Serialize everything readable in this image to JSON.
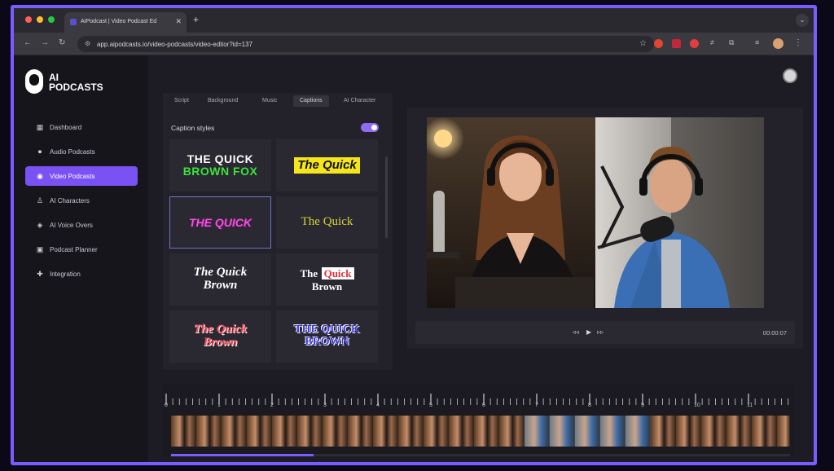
{
  "browser": {
    "tab_title": "AIPodcast | Video Podcast Ed",
    "tab_close": "✕",
    "new_tab": "+",
    "url": "app.aipodcasts.io/video-podcasts/video-editor?id=137"
  },
  "brand": {
    "line1": "AI",
    "line2": "PODCASTS"
  },
  "sidebar": {
    "items": [
      {
        "label": "Dashboard",
        "icon": "grid-icon",
        "glyph": "▦",
        "active": false
      },
      {
        "label": "Audio Podcasts",
        "icon": "microphone-icon",
        "glyph": "🎙",
        "active": false
      },
      {
        "label": "Video Podcasts",
        "icon": "broadcast-icon",
        "glyph": "◉",
        "active": true
      },
      {
        "label": "AI Characters",
        "icon": "character-icon",
        "glyph": "♙",
        "active": false
      },
      {
        "label": "AI Voice Overs",
        "icon": "voice-icon",
        "glyph": "◈",
        "active": false
      },
      {
        "label": "Podcast Planner",
        "icon": "calendar-icon",
        "glyph": "▣",
        "active": false
      },
      {
        "label": "Integration",
        "icon": "puzzle-icon",
        "glyph": "✚",
        "active": false
      }
    ]
  },
  "editor": {
    "tabs": [
      "Script",
      "Background",
      "Music",
      "Captions",
      "AI Character"
    ],
    "active_tab": "Captions",
    "caption_title": "Caption styles",
    "caption_enabled": true,
    "styles": [
      {
        "lines": [
          "THE QUICK",
          "BROWN FOX"
        ]
      },
      {
        "lines": [
          "The Quick"
        ]
      },
      {
        "lines": [
          "THE QUICK"
        ]
      },
      {
        "lines": [
          "The Quick"
        ]
      },
      {
        "lines": [
          "The Quick",
          "Brown"
        ]
      },
      {
        "lines": [
          "The",
          "Quick",
          "Brown"
        ]
      },
      {
        "lines": [
          "The Quick",
          "Brown"
        ]
      },
      {
        "lines": [
          "THE QUICK",
          "BROWN"
        ]
      }
    ]
  },
  "player": {
    "rewind": "◃◃",
    "play": "▶",
    "forward": "▹▹",
    "timecode": "00:00:07"
  },
  "timeline": {
    "labels": [
      "0",
      "1",
      "2",
      "3",
      "4",
      "5",
      "6",
      "7",
      "8",
      "9",
      "10",
      "11"
    ],
    "progress": 0.23
  },
  "colors": {
    "accent": "#7a52f4",
    "frame": "#7b5cff"
  }
}
